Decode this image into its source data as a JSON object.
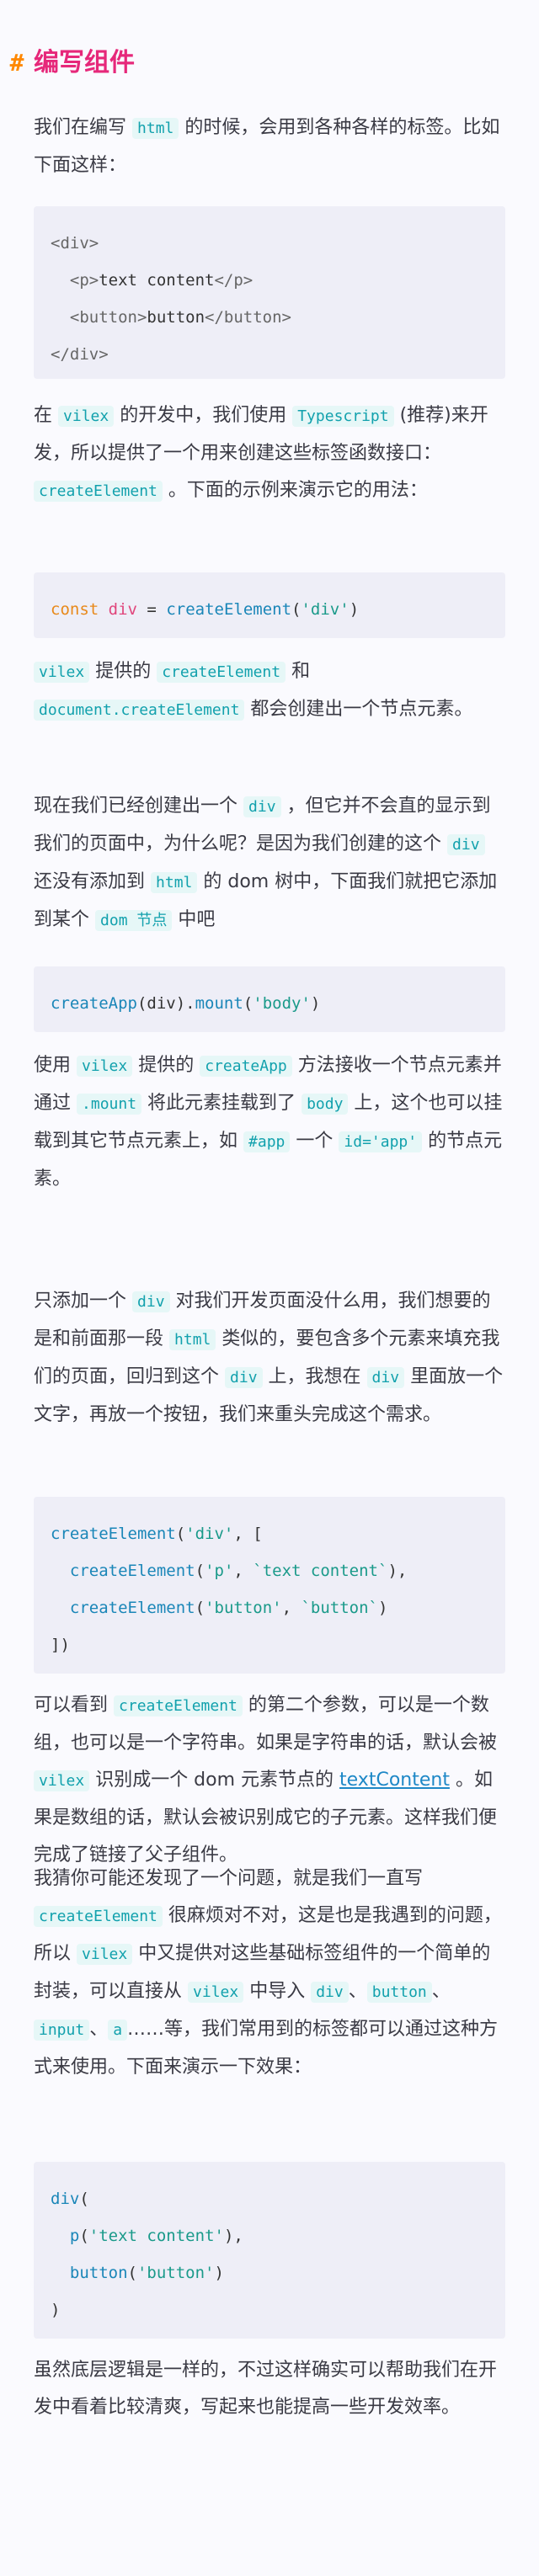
{
  "heading": {
    "hash": "#",
    "title": "编写组件"
  },
  "p1": {
    "t1": "我们在编写",
    "c1": "html",
    "t2": "的时候，会用到各种各样的标签。比如下面这样："
  },
  "code1": {
    "l1": "<div>",
    "l2a": "  <p>",
    "l2b": "text content",
    "l2c": "</p>",
    "l3a": "  <button>",
    "l3b": "button",
    "l3c": "</button>",
    "l4": "</div>"
  },
  "p2": {
    "t1": "在",
    "c1": "vilex",
    "t2": "的开发中，我们使用",
    "c2": "Typescript",
    "t3": "(推荐)来开发，所以提供了一个用来创建这些标签函数接口：",
    "c3": "createElement",
    "t4": "。下面的示例来演示它的用法："
  },
  "code2": {
    "kw": "const",
    "var": "div",
    "eq": " = ",
    "fn": "createElement",
    "po": "(",
    "str": "'div'",
    "pc": ")"
  },
  "p3": {
    "c1": "vilex",
    "t1": "提供的",
    "c2": "createElement",
    "t2": "和",
    "c3": "document.createElement",
    "t3": "都会创建出一个节点元素。"
  },
  "p4": {
    "t1": "现在我们已经创建出一个",
    "c1": "div",
    "t2": "，但它并不会直的显示到我们的页面中，为什么呢？是因为我们创建的这个",
    "c2": "div",
    "t3": "还没有添加到",
    "c3": "html",
    "t4": "的 dom 树中，下面我们就把它添加到某个",
    "c4": "dom 节点",
    "t5": "中吧"
  },
  "code3": {
    "fn1": "createApp",
    "a1": "(div).",
    "fn2": "mount",
    "a2": "(",
    "str": "'body'",
    "a3": ")"
  },
  "p5": {
    "t1": "使用",
    "c1": "vilex",
    "t2": "提供的",
    "c2": "createApp",
    "t3": "方法接收一个节点元素并通过",
    "c3": ".mount",
    "t4": "将此元素挂载到了",
    "c4": "body",
    "t5": "上，这个也可以挂载到其它节点元素上，如",
    "c5": "#app",
    "t6": "一个",
    "c6": "id='app'",
    "t7": "的节点元素。"
  },
  "p6": {
    "t1": "只添加一个",
    "c1": "div",
    "t2": "对我们开发页面没什么用，我们想要的是和前面那一段",
    "c2": "html",
    "t3": "类似的，要包含多个元素来填充我们的页面，回归到这个",
    "c3": "div",
    "t4": "上，我想在",
    "c4": "div",
    "t5": "里面放一个文字，再放一个按钮，我们来重头完成这个需求。"
  },
  "code4": {
    "l1fn": "createElement",
    "l1a": "(",
    "l1s": "'div'",
    "l1b": ", [",
    "l2fn": "createElement",
    "l2a": "(",
    "l2s1": "'p'",
    "l2b": ", ",
    "l2s2": "`text content`",
    "l2c": "),",
    "l3fn": "createElement",
    "l3a": "(",
    "l3s1": "'button'",
    "l3b": ", ",
    "l3s2": "`button`",
    "l3c": ")",
    "l4": "])"
  },
  "p7": {
    "t1": "可以看到",
    "c1": "createElement",
    "t2": "的第二个参数，可以是一个数组，也可以是一个字符串。如果是字符串的话，默认会被",
    "c2": "vilex",
    "t3": "识别成一个 dom 元素节点的",
    "link": "textContent",
    "t4": "。如果是数组的话，默认会被识别成它的子元素。这样我们便完成了链接了父子组件。"
  },
  "p8": {
    "t1": "我猜你可能还发现了一个问题，就是我们一直写",
    "c1": "createElement",
    "t2": "很麻烦对不对，这是也是我遇到的问题，所以",
    "c2": "vilex",
    "t3": "中又提供对这些基础标签组件的一个简单的封装，可以直接从",
    "c3": "vilex",
    "t4": "中导入",
    "c4": "div",
    "t5": "、",
    "c5": "button",
    "t6": "、",
    "c6": "input",
    "t7": "、",
    "c7": "a",
    "t8": "……等，我们常用到的标签都可以通过这种方式来使用。下面来演示一下效果："
  },
  "code5": {
    "l1fn": "div",
    "l1a": "(",
    "l2fn": "p",
    "l2a": "(",
    "l2s": "'text content'",
    "l2b": "),",
    "l3fn": "button",
    "l3a": "(",
    "l3s": "'button'",
    "l3b": ")",
    "l4": ")"
  },
  "p9": {
    "t1": "虽然底层逻辑是一样的，不过这样确实可以帮助我们在开发中看着比较清爽，写起来也能提高一些开发效率。"
  }
}
